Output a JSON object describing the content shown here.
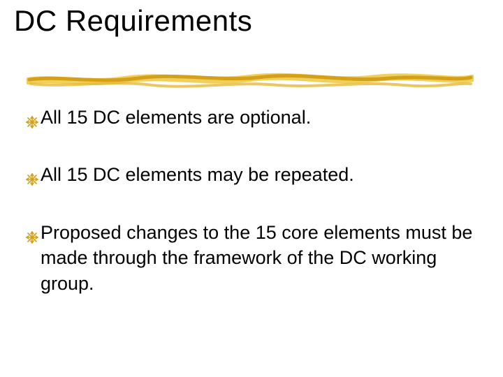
{
  "title": "DC Requirements",
  "bullets": [
    {
      "text": "All 15 DC elements are optional."
    },
    {
      "text": "All 15 DC elements may be repeated."
    },
    {
      "text": "Proposed changes to the 15 core elements must be made through the framework of the DC working group."
    }
  ],
  "colors": {
    "accent": "#d4a017",
    "accent_light": "#f0cf5a"
  }
}
